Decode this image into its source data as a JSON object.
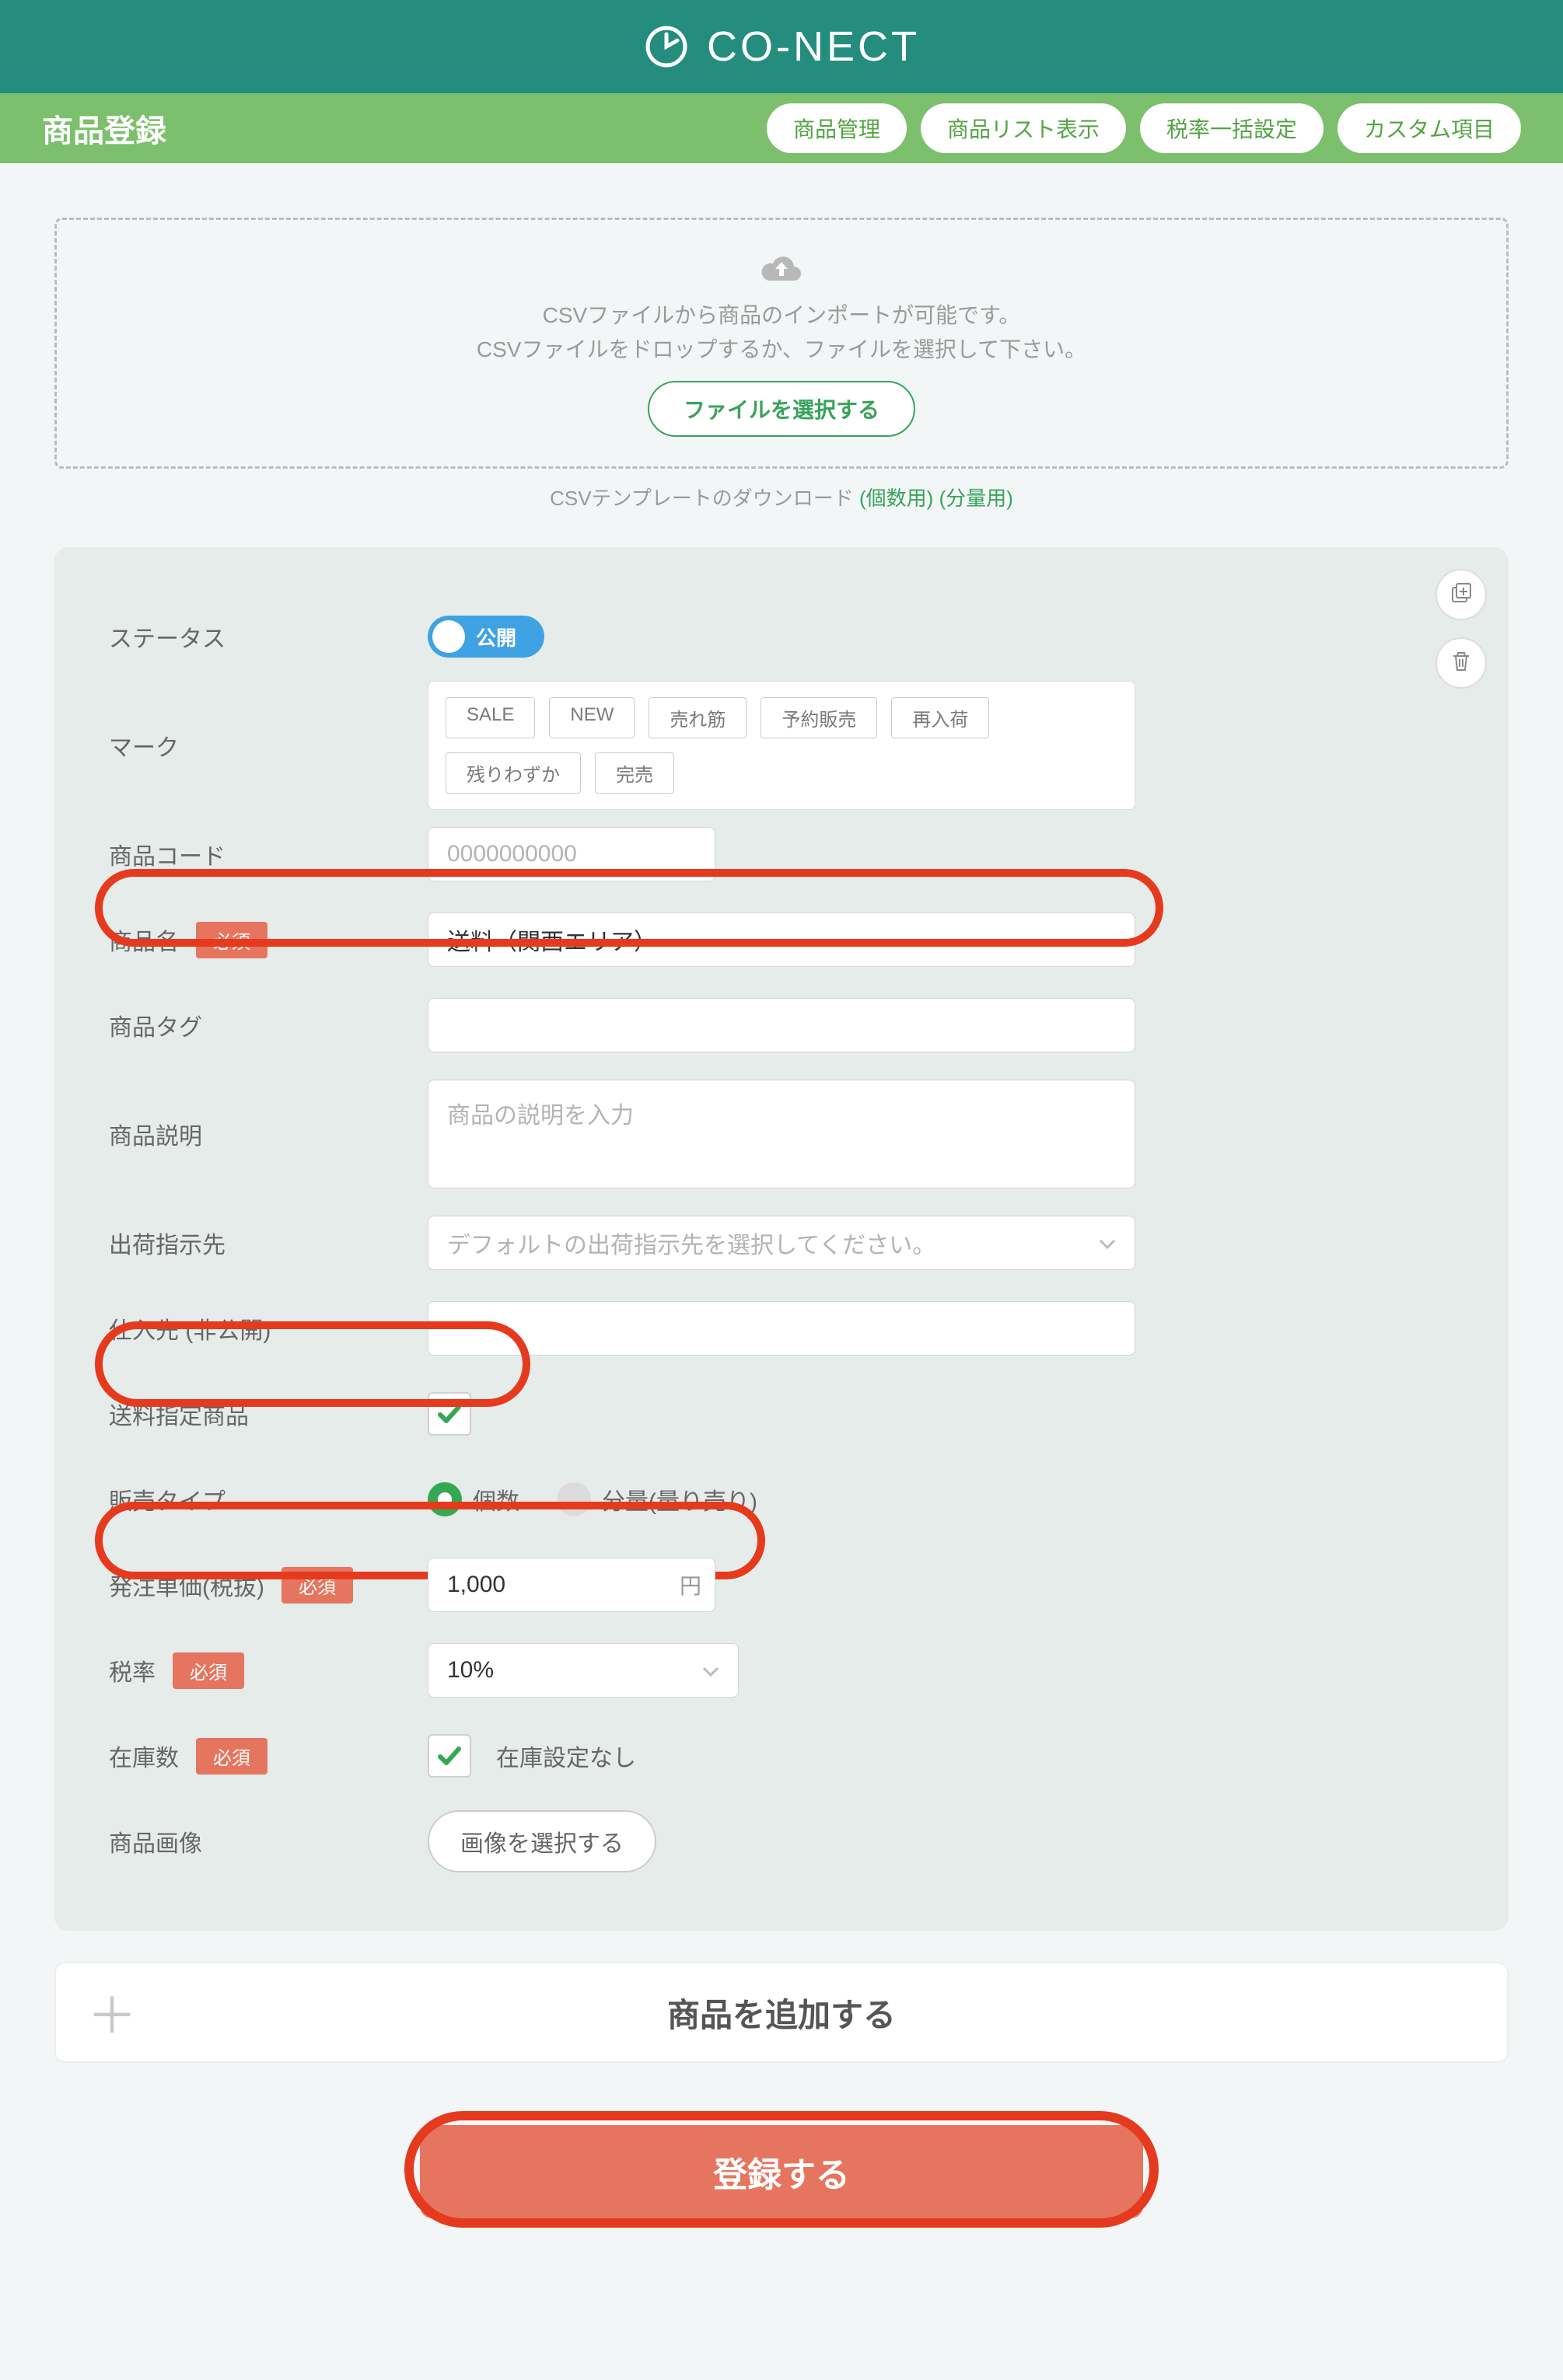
{
  "brand": {
    "name": "CO-NECT"
  },
  "page_title": "商品登録",
  "nav": {
    "items": [
      {
        "label": "商品管理"
      },
      {
        "label": "商品リスト表示"
      },
      {
        "label": "税率一括設定"
      },
      {
        "label": "カスタム項目"
      }
    ]
  },
  "upload": {
    "line1": "CSVファイルから商品のインポートが可能です。",
    "line2": "CSVファイルをドロップするか、ファイルを選択して下さい。",
    "button": "ファイルを選択する"
  },
  "csv_template": {
    "prefix": "CSVテンプレートのダウンロード",
    "link_single": "(個数用)",
    "link_bulk": "(分量用)"
  },
  "status": {
    "label": "ステータス",
    "toggle_text": "公開"
  },
  "mark": {
    "label": "マーク",
    "chips": [
      "SALE",
      "NEW",
      "売れ筋",
      "予約販売",
      "再入荷",
      "残りわずか",
      "完売"
    ]
  },
  "product_code": {
    "label": "商品コード",
    "placeholder": "0000000000"
  },
  "product_name": {
    "label": "商品名",
    "required": "必須",
    "value": "送料（関西エリア）"
  },
  "product_tag": {
    "label": "商品タグ"
  },
  "product_desc": {
    "label": "商品説明",
    "placeholder": "商品の説明を入力"
  },
  "ship_dest": {
    "label": "出荷指示先",
    "placeholder": "デフォルトの出荷指示先を選択してください。"
  },
  "supplier": {
    "label": "仕入先 (非公開)"
  },
  "shipping_flag": {
    "label": "送料指定商品"
  },
  "sale_type": {
    "label": "販売タイプ",
    "option_count": "個数",
    "option_weight": "分量(量り売り)"
  },
  "unit_price": {
    "label": "発注単価(税抜)",
    "required": "必須",
    "value": "1,000",
    "unit": "円"
  },
  "tax_rate": {
    "label": "税率",
    "required": "必須",
    "value": "10%"
  },
  "stock": {
    "label": "在庫数",
    "required": "必須",
    "no_stock_label": "在庫設定なし"
  },
  "product_image": {
    "label": "商品画像",
    "button": "画像を選択する"
  },
  "add_product": {
    "label": "商品を追加する"
  },
  "submit": {
    "label": "登録する"
  }
}
